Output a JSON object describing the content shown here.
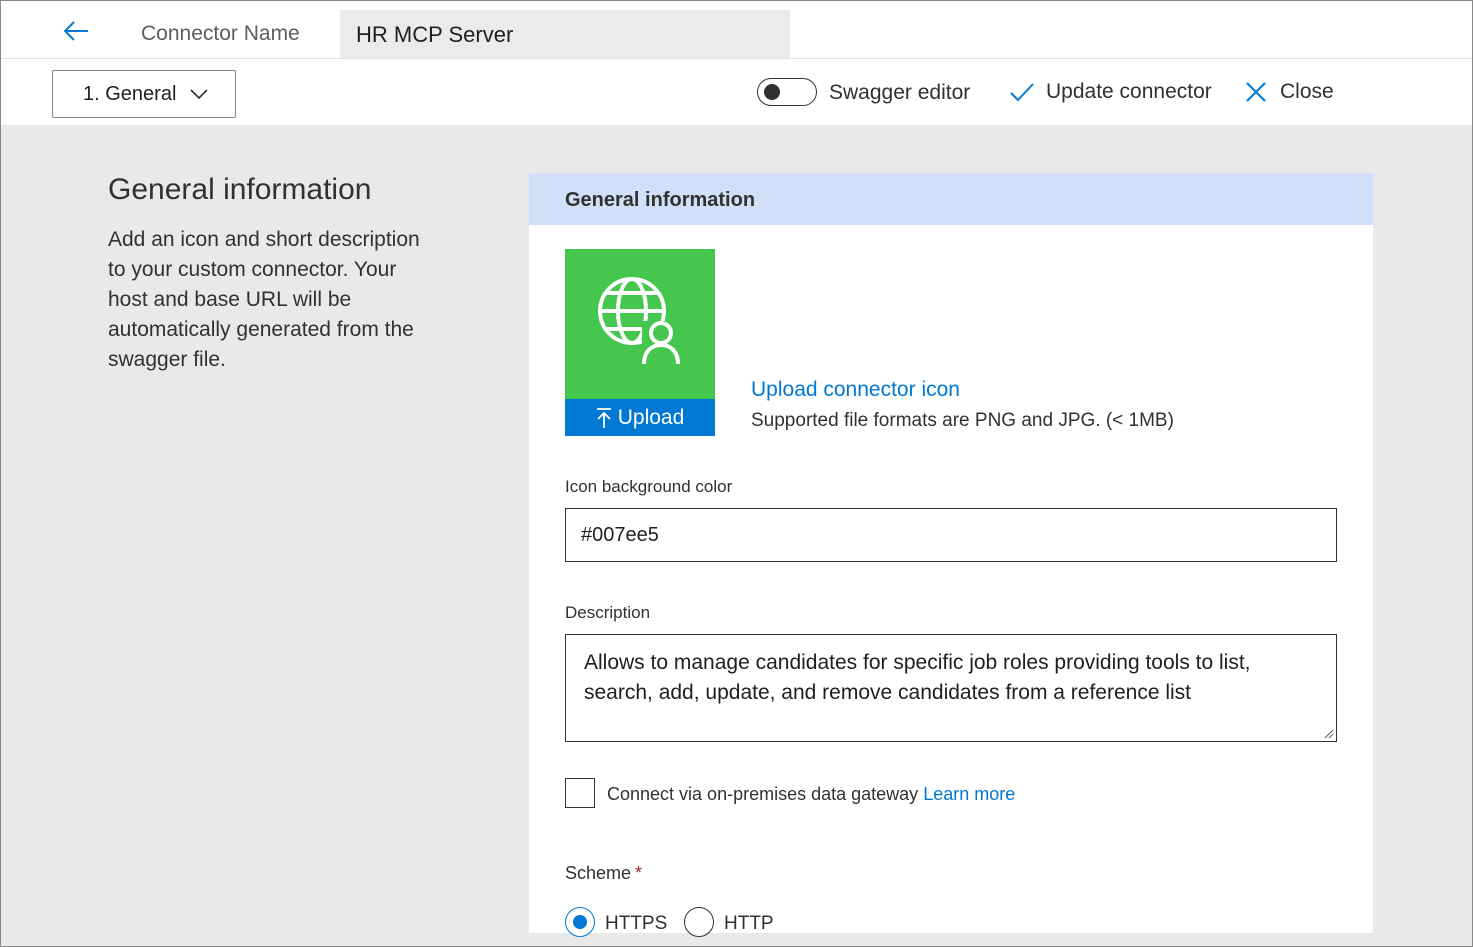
{
  "header": {
    "back_icon": "arrow-left-icon",
    "connector_name_label": "Connector Name",
    "connector_name_value": "HR MCP Server"
  },
  "toolbar": {
    "step_dropdown": "1. General",
    "swagger_toggle_label": "Swagger editor",
    "swagger_toggle_on": false,
    "update_label": "Update connector",
    "close_label": "Close"
  },
  "left": {
    "title": "General information",
    "description": "Add an icon and short description to your custom connector. Your host and base URL will be automatically generated from the swagger file."
  },
  "panel": {
    "header": "General information",
    "icon_tile_color": "#45c64e",
    "icon_glyph": "globe-person-icon",
    "upload_button": "Upload",
    "upload_link": "Upload connector icon",
    "upload_hint": "Supported file formats are PNG and JPG. (< 1MB)",
    "icon_bg_label": "Icon background color",
    "icon_bg_value": "#007ee5",
    "description_label": "Description",
    "description_value": "Allows to manage candidates for specific job roles providing tools to list, search, add, update, and remove candidates from a reference list",
    "gateway_label": "Connect via on-premises data gateway",
    "gateway_checked": false,
    "learn_more": "Learn more",
    "scheme_label": "Scheme",
    "scheme_required": "*",
    "scheme_options": [
      "HTTPS",
      "HTTP"
    ],
    "scheme_selected": "HTTPS"
  },
  "colors": {
    "accent": "#0078d4",
    "panel_header_bg": "#cfe0f8",
    "page_bg": "#e9e9e9"
  }
}
